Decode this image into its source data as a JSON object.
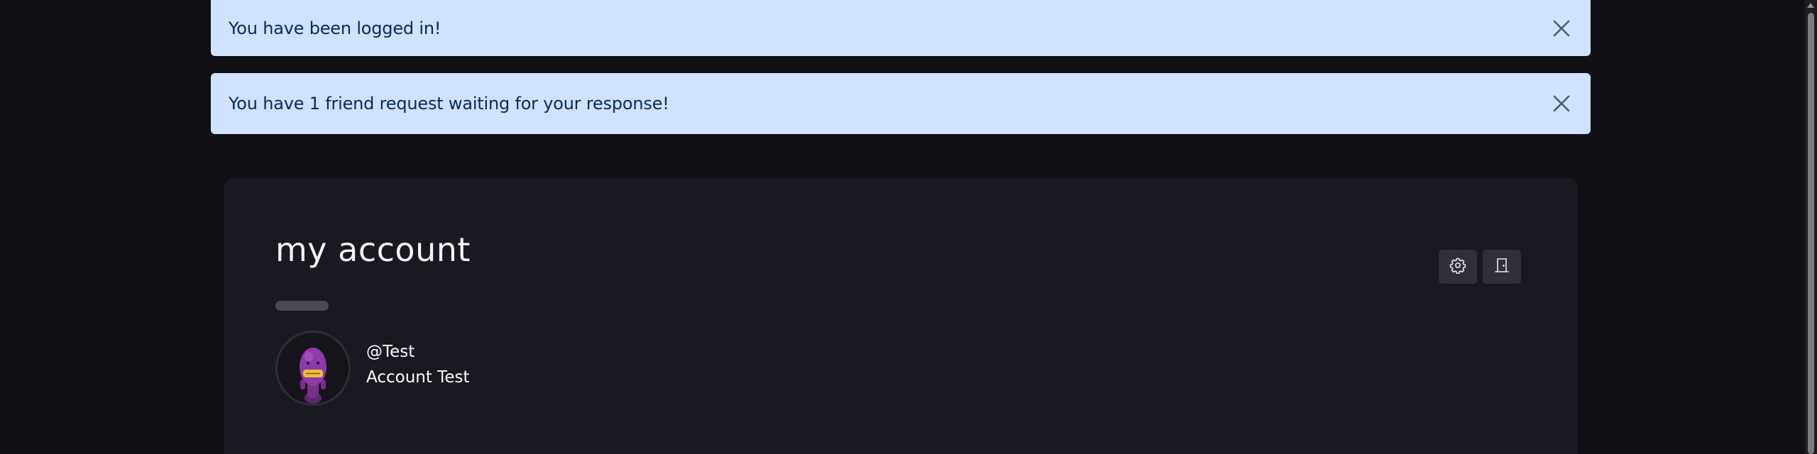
{
  "alerts": [
    {
      "message": "You have been logged in!",
      "close_icon": "close-icon"
    },
    {
      "message": "You have 1 friend request waiting for your response!",
      "close_icon": "close-icon"
    }
  ],
  "account": {
    "title": "my account",
    "handle": "@Test",
    "full_name": "Account Test",
    "avatar_icon": "purple-character-avatar"
  },
  "actions": {
    "settings_icon": "gear-icon",
    "logout_icon": "door-exit-icon"
  },
  "colors": {
    "background": "#0f0f14",
    "card": "#1a1820",
    "alert_bg": "#cfe2ff",
    "alert_text": "#052c65",
    "button_bg": "#303038"
  }
}
